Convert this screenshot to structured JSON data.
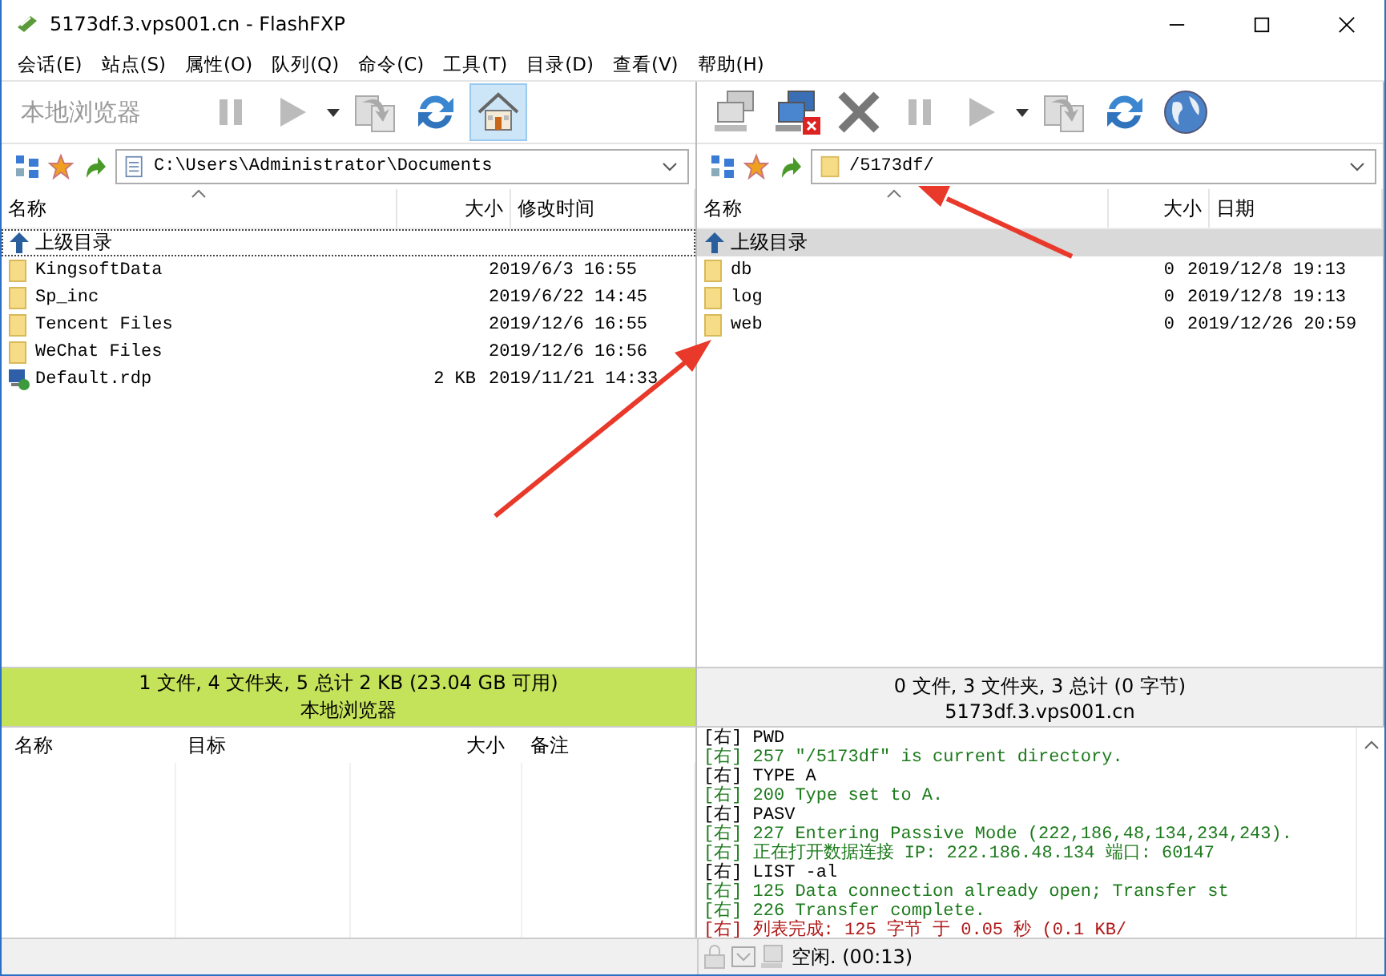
{
  "window": {
    "title": "5173df.3.vps001.cn - FlashFXP"
  },
  "menu": [
    "会话(E)",
    "站点(S)",
    "属性(O)",
    "队列(Q)",
    "命令(C)",
    "工具(T)",
    "目录(D)",
    "查看(V)",
    "帮助(H)"
  ],
  "left": {
    "label": "本地浏览器",
    "toolbar": [
      {
        "kind": "pause",
        "pressed": false
      },
      {
        "kind": "play",
        "pressed": false
      },
      {
        "kind": "dropdown",
        "pressed": false
      },
      {
        "kind": "transfer",
        "pressed": false
      },
      {
        "kind": "refresh",
        "pressed": false
      },
      {
        "kind": "home",
        "pressed": true
      }
    ],
    "path": {
      "kind": "document",
      "text": "C:\\Users\\Administrator\\Documents"
    },
    "columns": [
      "名称",
      "大小",
      "修改时间"
    ],
    "rows": [
      {
        "kind": "up",
        "name": "上级目录",
        "size": "",
        "date": "",
        "selected": false,
        "focused": true
      },
      {
        "kind": "folder",
        "name": "KingsoftData",
        "size": "",
        "date": "2019/6/3 16:55",
        "selected": false,
        "focused": false
      },
      {
        "kind": "folder",
        "name": "Sp_inc",
        "size": "",
        "date": "2019/6/22 14:45",
        "selected": false,
        "focused": false
      },
      {
        "kind": "folder",
        "name": "Tencent Files",
        "size": "",
        "date": "2019/12/6 16:55",
        "selected": false,
        "focused": false
      },
      {
        "kind": "folder",
        "name": "WeChat Files",
        "size": "",
        "date": "2019/12/6 16:56",
        "selected": false,
        "focused": false
      },
      {
        "kind": "file",
        "name": "Default.rdp",
        "size": "2 KB",
        "date": "2019/11/21 14:33",
        "selected": false,
        "focused": false
      }
    ],
    "status": {
      "summary": "1 文件, 4 文件夹, 5 总计 2 KB (23.04 GB 可用)",
      "label": "本地浏览器",
      "active": true
    }
  },
  "right": {
    "toolbar": [
      {
        "kind": "connect",
        "pressed": false
      },
      {
        "kind": "disconnect",
        "pressed": false
      },
      {
        "kind": "abort",
        "pressed": false
      },
      {
        "kind": "pause",
        "pressed": false
      },
      {
        "kind": "play",
        "pressed": false
      },
      {
        "kind": "dropdown",
        "pressed": false
      },
      {
        "kind": "transfer",
        "pressed": false
      },
      {
        "kind": "refresh",
        "pressed": false
      },
      {
        "kind": "globe",
        "pressed": false
      }
    ],
    "path": {
      "kind": "folder",
      "text": "/5173df/"
    },
    "columns": [
      "名称",
      "大小",
      "日期"
    ],
    "rows": [
      {
        "kind": "up",
        "name": "上级目录",
        "size": "",
        "date": "",
        "selected": true,
        "focused": false
      },
      {
        "kind": "folder",
        "name": "db",
        "size": "0",
        "date": "2019/12/8 19:13",
        "selected": false,
        "focused": false
      },
      {
        "kind": "folder",
        "name": "log",
        "size": "0",
        "date": "2019/12/8 19:13",
        "selected": false,
        "focused": false
      },
      {
        "kind": "folder",
        "name": "web",
        "size": "0",
        "date": "2019/12/26 20:59",
        "selected": false,
        "focused": false
      }
    ],
    "status": {
      "summary": "0 文件, 3 文件夹, 3 总计 (0 字节)",
      "label": "5173df.3.vps001.cn",
      "active": false
    }
  },
  "queue": {
    "columns": [
      "名称",
      "目标",
      "大小",
      "备注"
    ]
  },
  "log": [
    {
      "kind": "command",
      "text": "[右] PWD"
    },
    {
      "kind": "reply",
      "text": "[右] 257 \"/5173df\" is current directory."
    },
    {
      "kind": "command",
      "text": "[右] TYPE A"
    },
    {
      "kind": "reply",
      "text": "[右] 200 Type set to A."
    },
    {
      "kind": "command",
      "text": "[右] PASV"
    },
    {
      "kind": "reply",
      "text": "[右] 227 Entering Passive Mode (222,186,48,134,234,243)."
    },
    {
      "kind": "reply",
      "text": "[右] 正在打开数据连接 IP: 222.186.48.134 端口: 60147"
    },
    {
      "kind": "command",
      "text": "[右] LIST -al"
    },
    {
      "kind": "reply",
      "text": "[右] 125 Data connection already open; Transfer st"
    },
    {
      "kind": "reply",
      "text": "[右] 226 Transfer complete."
    },
    {
      "kind": "status",
      "text": "[右] 列表完成: 125 字节 于 0.05 秒 (0.1 KB/"
    }
  ],
  "status_bar": {
    "text": "空闲. (00:13)"
  }
}
